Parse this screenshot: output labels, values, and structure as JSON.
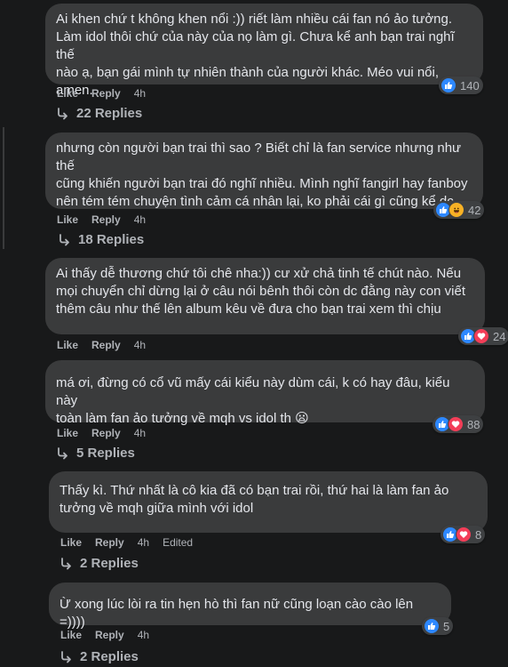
{
  "comments": [
    {
      "text": "Ai khen chứ t không khen nổi :)) riết làm nhiều cái fan nó ảo tưởng.\nLàm idol thôi chứ của này của nọ làm gì. Chưa kể anh bạn trai nghĩ thế\nnào ạ, bạn gái mình tự nhiên thành của người khác. Méo vui nổi, amen.",
      "like": "Like",
      "reply": "Reply",
      "time": "4h",
      "edited": "",
      "reaction_count": "140",
      "reactions": [
        "like"
      ],
      "replies": "22 Replies"
    },
    {
      "text": "nhưng còn người bạn trai thì sao ? Biết chỉ là fan service nhưng như thế\ncũng khiến người bạn trai đó nghĩ nhiều. Mình nghĩ fangirl hay fanboy\nnên tém tém chuyện tình cảm cá nhân lại, ko phải cái gì cũng kể dc",
      "like": "Like",
      "reply": "Reply",
      "time": "4h",
      "edited": "",
      "reaction_count": "42",
      "reactions": [
        "like",
        "haha"
      ],
      "replies": "18 Replies"
    },
    {
      "text": "Ai thấy dễ thương chứ tôi chê nha:)) cư xử chả tinh tế chút nào. Nếu\nmọi chuyển chỉ dừng lại ở câu nói bênh thôi còn dc đằng này con viết\nthêm câu như thế lên album kêu về đưa cho bạn trai xem thì chịu",
      "like": "Like",
      "reply": "Reply",
      "time": "4h",
      "edited": "",
      "reaction_count": "24",
      "reactions": [
        "like",
        "love"
      ],
      "replies": ""
    },
    {
      "text": "má ơi, đừng có cổ vũ mấy cái kiểu này dùm cái, k có hay đâu, kiểu này\ntoàn làm fan ảo tưởng về mqh vs idol th 😦",
      "like": "Like",
      "reply": "Reply",
      "time": "4h",
      "edited": "",
      "reaction_count": "88",
      "reactions": [
        "like",
        "love"
      ],
      "replies": "5 Replies"
    },
    {
      "text": "Thấy kì. Thứ nhất là cô kia đã có bạn trai rồi, thứ hai là làm fan ảo\ntưởng về mqh giữa mình với idol",
      "like": "Like",
      "reply": "Reply",
      "time": "4h",
      "edited": "Edited",
      "reaction_count": "8",
      "reactions": [
        "like",
        "love"
      ],
      "replies": "2 Replies"
    },
    {
      "text": "Ừ xong lúc lòi ra tin hẹn hò thì fan nữ cũng loạn cào cào lên =))))",
      "like": "Like",
      "reply": "Reply",
      "time": "4h",
      "edited": "",
      "reaction_count": "5",
      "reactions": [
        "like"
      ],
      "replies": "2 Replies"
    }
  ],
  "colors": {
    "bubble": "#3a3b3c",
    "background": "#18191a",
    "like": "#2d88ff",
    "love": "#f33e58"
  }
}
